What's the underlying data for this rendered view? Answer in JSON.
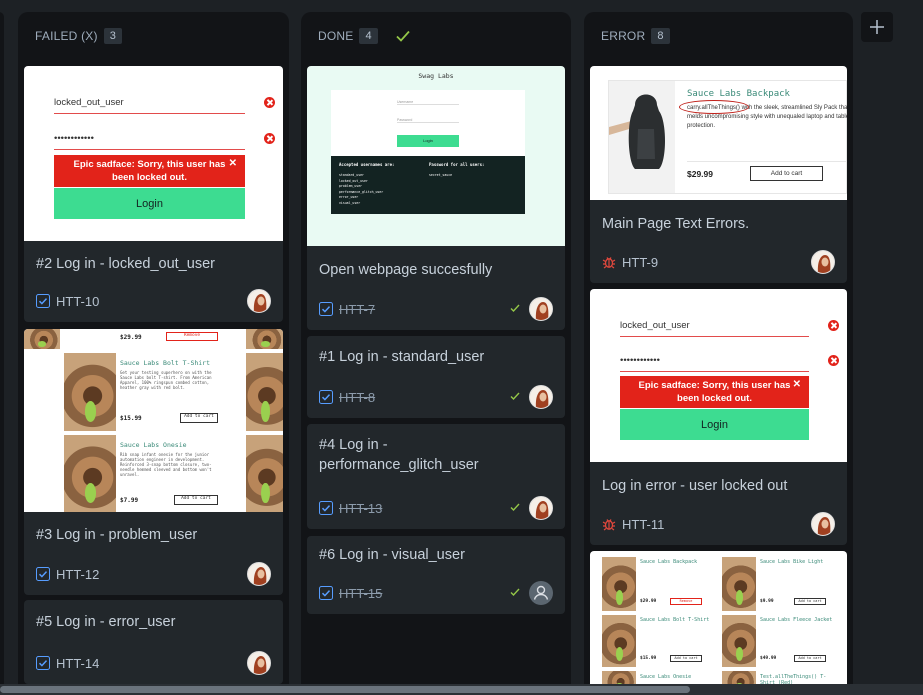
{
  "board": {
    "columns": [
      {
        "name": "FAILED (X)",
        "count": "3"
      },
      {
        "name": "DONE",
        "count": "4"
      },
      {
        "name": "ERROR",
        "count": "8"
      }
    ]
  },
  "failed": {
    "cards": [
      {
        "title": "#2 Log in - locked_out_user",
        "key": "HTT-10"
      },
      {
        "title": "#3 Log in - problem_user",
        "key": "HTT-12"
      },
      {
        "title": "#5 Log in - error_user",
        "key": "HTT-14"
      }
    ],
    "login_thumb": {
      "username": "locked_out_user",
      "password": "••••••••••••",
      "error": "Epic sadface: Sorry, this user has been locked out.",
      "button": "Login",
      "close": "✕"
    },
    "problem_thumb": {
      "price_top": "$29.99",
      "remove": "Remove",
      "p1_title": "Sauce Labs Bolt T-Shirt",
      "p1_text": "Get your testing superhero on with the Sauce Labs bolt T-shirt. From American Apparel, 100% ringspun combed cotton, heather gray with red bolt.",
      "p1_price": "$15.99",
      "p2_title": "Sauce Labs Onesie",
      "p2_text": "Rib snap infant onesie for the junior automation engineer in development. Reinforced 3-snap bottom closure, two-needle hemmed sleeved and bottom won't unravel.",
      "p2_price": "$7.99",
      "add": "Add to cart"
    }
  },
  "done": {
    "cards": [
      {
        "title": "Open webpage succesfully",
        "key": "HTT-7"
      },
      {
        "title": "#1 Log in - standard_user",
        "key": "HTT-8"
      },
      {
        "title": "#4 Log in - performance_glitch_user",
        "key": "HTT-13"
      },
      {
        "title": "#6 Log in - visual_user",
        "key": "HTT-15"
      }
    ],
    "swag_thumb": {
      "logo": "Swag Labs",
      "user_ph": "Username",
      "pass_ph": "Password",
      "login": "Login",
      "usernames_title": "Accepted usernames are:",
      "usernames": "standard_user\nlocked_out_user\nproblem_user\nperformance_glitch_user\nerror_user\nvisual_user",
      "password_title": "Password for all users:",
      "password": "secret_sauce"
    }
  },
  "error": {
    "cards": [
      {
        "title": "Main Page Text Errors.",
        "key": "HTT-9"
      },
      {
        "title": "Log in error - user locked out",
        "key": "HTT-11"
      }
    ],
    "backpack_thumb": {
      "title": "Sauce Labs Backpack",
      "text": "carry.allTheThings() with the sleek, streamlined Sly Pack that melds uncompromising style with unequaled laptop and tablet protection.",
      "price": "$29.99",
      "add": "Add to cart"
    },
    "grid_thumb": {
      "a_title": "Sauce Labs Backpack",
      "b_title": "Sauce Labs Bike Light",
      "c_title": "Sauce Labs Bolt T-Shirt",
      "d_title": "Sauce Labs Fleece Jacket",
      "e_title": "Sauce Labs Onesie",
      "f_title": "Test.allTheThings() T-Shirt (Red)",
      "a_price": "$29.99",
      "b_price": "$9.99",
      "c_price": "$15.99",
      "d_price": "$49.99",
      "remove": "Remove",
      "add": "Add to cart"
    }
  },
  "colors": {
    "accent": "#579dff",
    "done_check": "#94c748",
    "bug": "#e2483d",
    "login_green": "#3ddc91",
    "error_red": "#e2231a"
  }
}
